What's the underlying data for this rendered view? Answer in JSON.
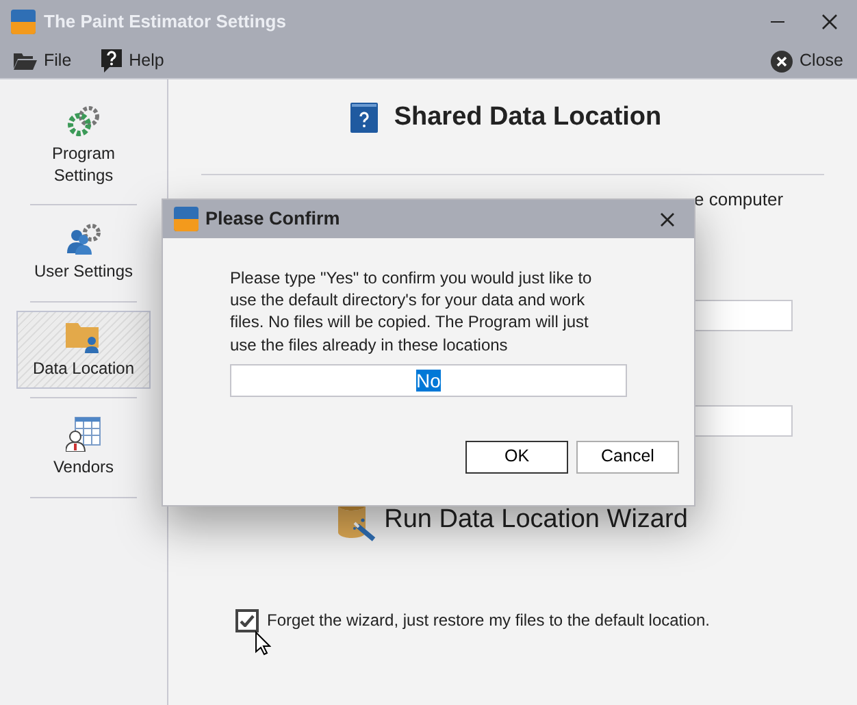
{
  "window": {
    "title": "The Paint Estimator Settings"
  },
  "menu": [
    {
      "label": "File",
      "kind": "file"
    },
    {
      "label": "Help",
      "kind": "help"
    }
  ],
  "close_button": {
    "label": "Close"
  },
  "sidebar": {
    "items": [
      {
        "label": "Program Settings",
        "kind": "gears",
        "selected": false
      },
      {
        "label": "User Settings",
        "kind": "users",
        "selected": false
      },
      {
        "label": "Data Location",
        "kind": "folder",
        "selected": true
      },
      {
        "label": "Vendors",
        "kind": "vendors",
        "selected": false
      }
    ]
  },
  "page": {
    "title": "Shared Data Location",
    "partial_text": "e computer",
    "wizard_button": {
      "label": "Run Data Location Wizard"
    },
    "restore_checkbox": {
      "label": "Forget the wizard, just restore my files to the default location.",
      "checked": true
    }
  },
  "dialog": {
    "title": "Please Confirm",
    "message": "Please type \"Yes\" to confirm you would just like to use the default directory's for your data and work files. No files will be copied. The Program will just use the files already in these locations",
    "input": {
      "value": "No"
    },
    "buttons": [
      {
        "label": "OK",
        "default": true
      },
      {
        "label": "Cancel",
        "default": false
      }
    ]
  }
}
